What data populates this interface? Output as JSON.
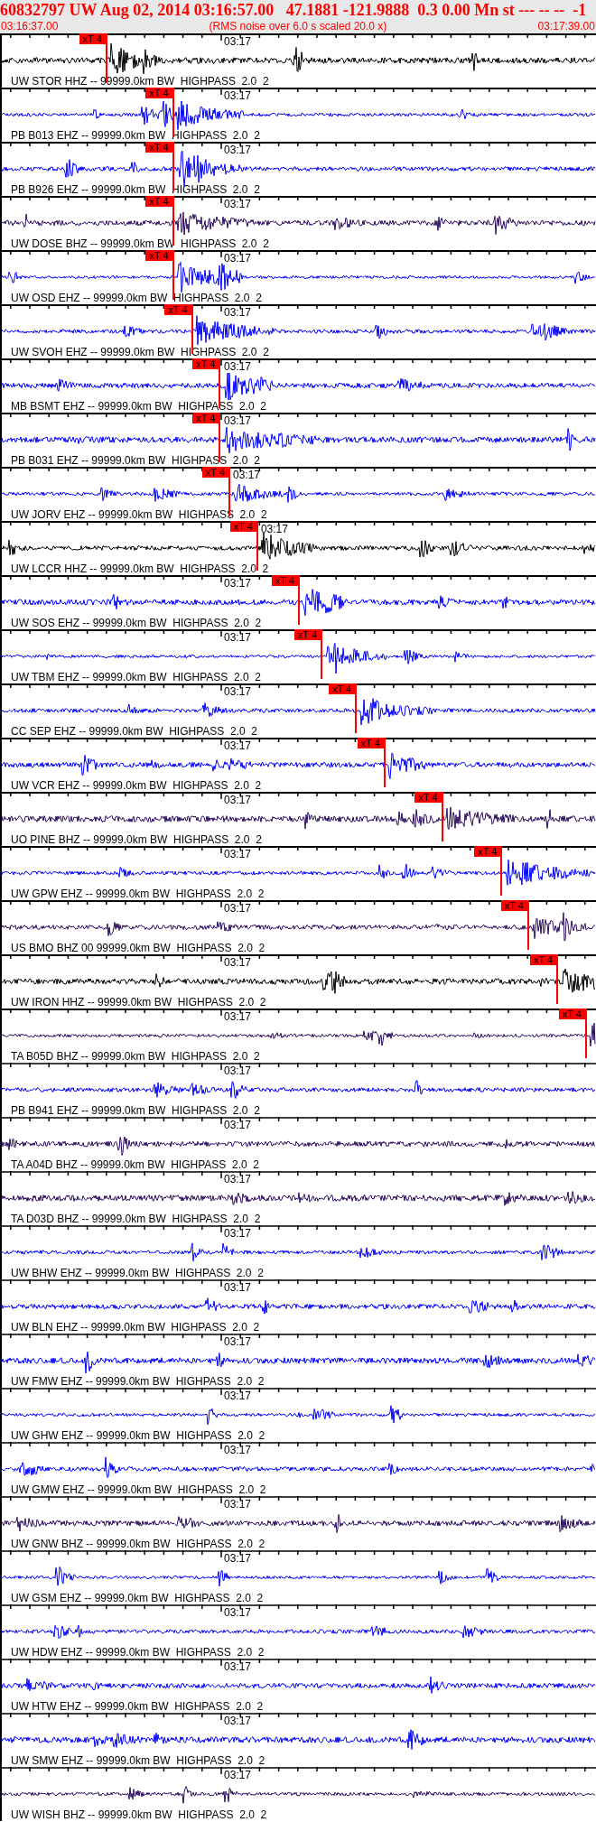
{
  "header": {
    "title": "60832797 UW Aug 02, 2014 03:16:57.00   47.1881 -121.9888  0.3 0.00 Mn st --- -- --  -1",
    "start_time": "03:16:37.00",
    "note": "(RMS noise over 6.0 s scaled 20.0 x)",
    "end_time": "03:17:39.00"
  },
  "traces": [
    {
      "label": "UW STOR HHZ -- 99999.0km BW  HIGHPASS  2.0  2",
      "time_label": "03:17",
      "color": "#000000",
      "marker": {
        "label": "xT 4",
        "level": 0.176
      }
    },
    {
      "label": "PB B013 EHZ -- 99999.0km BW  HIGHPASS  2.0  2",
      "time_label": "03:17",
      "color": "#0000ff",
      "marker": {
        "label": "xT 4",
        "level": 0.288
      }
    },
    {
      "label": "PB B926 EHZ -- 99999.0km BW  HIGHPASS  2.0  2",
      "time_label": "03:17",
      "color": "#0000ff",
      "marker": {
        "label": "xT 4",
        "level": 0.288
      }
    },
    {
      "label": "UW DOSE BHZ -- 99999.0km BW  HIGHPASS  2.0  2",
      "time_label": "03:17",
      "color": "#2a0a5e",
      "marker": {
        "label": "xT 4",
        "level": 0.288
      }
    },
    {
      "label": "UW OSD EHZ -- 99999.0km BW  HIGHPASS  2.0  2",
      "time_label": "03:17",
      "color": "#0000ff",
      "marker": {
        "label": "xT 4",
        "level": 0.288
      }
    },
    {
      "label": "UW SVOH EHZ -- 99999.0km BW  HIGHPASS  2.0  2",
      "time_label": "03:17",
      "color": "#0000ff",
      "marker": {
        "label": "xT 4",
        "level": 0.32
      }
    },
    {
      "label": "MB BSMT EHZ -- 99999.0km BW  HIGHPASS  2.0  2",
      "time_label": "03:17",
      "color": "#0000ff",
      "marker": {
        "label": "xT 4",
        "level": 0.367
      }
    },
    {
      "label": "PB B031 EHZ -- 99999.0km BW  HIGHPASS  2.0  2",
      "time_label": "03:17",
      "color": "#0000ff",
      "marker": {
        "label": "xT 4",
        "level": 0.367
      }
    },
    {
      "label": "UW JORV EHZ -- 99999.0km BW  HIGHPASS  2.0  2",
      "time_label": "03:17",
      "color": "#0000ff",
      "marker": {
        "label": "xT 4",
        "level": 0.383
      }
    },
    {
      "label": "UW LCCR HHZ -- 99999.0km BW  HIGHPASS  2.0  2",
      "time_label": "03:17",
      "color": "#000000",
      "marker": {
        "label": "xT 4",
        "level": 0.43
      }
    },
    {
      "label": "UW SOS EHZ -- 99999.0km BW  HIGHPASS  2.0  2",
      "time_label": "03:17",
      "color": "#0000ff",
      "marker": {
        "label": "xT 4",
        "level": 0.5
      }
    },
    {
      "label": "UW TBM EHZ -- 99999.0km BW  HIGHPASS  2.0  2",
      "time_label": "03:17",
      "color": "#0000ff",
      "marker": {
        "label": "xT 4",
        "level": 0.538
      }
    },
    {
      "label": "CC SEP EHZ -- 99999.0km BW  HIGHPASS  2.0  2",
      "time_label": "03:17",
      "color": "#0000ff",
      "marker": {
        "label": "xT 4",
        "level": 0.596
      }
    },
    {
      "label": "UW VCR EHZ -- 99999.0km BW  HIGHPASS  2.0  2",
      "time_label": "03:17",
      "color": "#0000ff",
      "marker": {
        "label": "xT 4",
        "level": 0.644
      }
    },
    {
      "label": "UO PINE BHZ -- 99999.0km BW  HIGHPASS  2.0  2",
      "time_label": "03:17",
      "color": "#2a0a5e",
      "marker": {
        "label": "xT 4",
        "level": 0.741
      }
    },
    {
      "label": "UW GPW EHZ -- 99999.0km BW  HIGHPASS  2.0  2",
      "time_label": "03:17",
      "color": "#0000ff",
      "marker": {
        "label": "xT 4",
        "level": 0.841
      }
    },
    {
      "label": "US BMO BHZ 00 99999.0km BW  HIGHPASS  2.0  2",
      "time_label": "03:17",
      "color": "#2a0a5e",
      "marker": {
        "label": "xT 4",
        "level": 0.886
      }
    },
    {
      "label": "UW IRON HHZ -- 99999.0km BW  HIGHPASS  2.0  2",
      "time_label": "03:17",
      "color": "#000000",
      "marker": {
        "label": "xT 4",
        "level": 0.935
      }
    },
    {
      "label": "TA B05D BHZ -- 99999.0km BW  HIGHPASS  2.0  2",
      "time_label": "03:17",
      "color": "#2a0a5e",
      "marker": {
        "label": "xT 4",
        "level": 0.983
      }
    },
    {
      "label": "PB B941 EHZ -- 99999.0km BW  HIGHPASS  2.0  2",
      "time_label": "03:17",
      "color": "#0000ff"
    },
    {
      "label": "TA A04D BHZ -- 99999.0km BW  HIGHPASS  2.0  2",
      "time_label": "03:17",
      "color": "#2a0a5e"
    },
    {
      "label": "TA D03D BHZ -- 99999.0km BW  HIGHPASS  2.0  2",
      "time_label": "03:17",
      "color": "#2a0a5e"
    },
    {
      "label": "UW BHW EHZ -- 99999.0km BW  HIGHPASS  2.0  2",
      "time_label": "03:17",
      "color": "#0000ff"
    },
    {
      "label": "UW BLN EHZ -- 99999.0km BW  HIGHPASS  2.0  2",
      "time_label": "03:17",
      "color": "#0000ff"
    },
    {
      "label": "UW FMW EHZ -- 99999.0km BW  HIGHPASS  2.0  2",
      "time_label": "03:17",
      "color": "#0000ff"
    },
    {
      "label": "UW GHW EHZ -- 99999.0km BW  HIGHPASS  2.0  2",
      "time_label": "03:17",
      "color": "#0000ff"
    },
    {
      "label": "UW GMW EHZ -- 99999.0km BW  HIGHPASS  2.0  2",
      "time_label": "03:17",
      "color": "#0000ff"
    },
    {
      "label": "UW GNW BHZ -- 99999.0km BW  HIGHPASS  2.0  2",
      "time_label": "03:17",
      "color": "#2a0a5e"
    },
    {
      "label": "UW GSM EHZ -- 99999.0km BW  HIGHPASS  2.0  2",
      "time_label": "03:17",
      "color": "#0000ff"
    },
    {
      "label": "UW HDW EHZ -- 99999.0km BW  HIGHPASS  2.0  2",
      "time_label": "03:17",
      "color": "#0000ff"
    },
    {
      "label": "UW HTW EHZ -- 99999.0km BW  HIGHPASS  2.0  2",
      "time_label": "03:17",
      "color": "#0000ff"
    },
    {
      "label": "UW SMW EHZ -- 99999.0km BW  HIGHPASS  2.0  2",
      "time_label": "03:17",
      "color": "#0000ff"
    },
    {
      "label": "UW WISH BHZ -- 99999.0km BW  HIGHPASS  2.0  2",
      "time_label": "03:17",
      "color": "#2a0a5e"
    }
  ]
}
